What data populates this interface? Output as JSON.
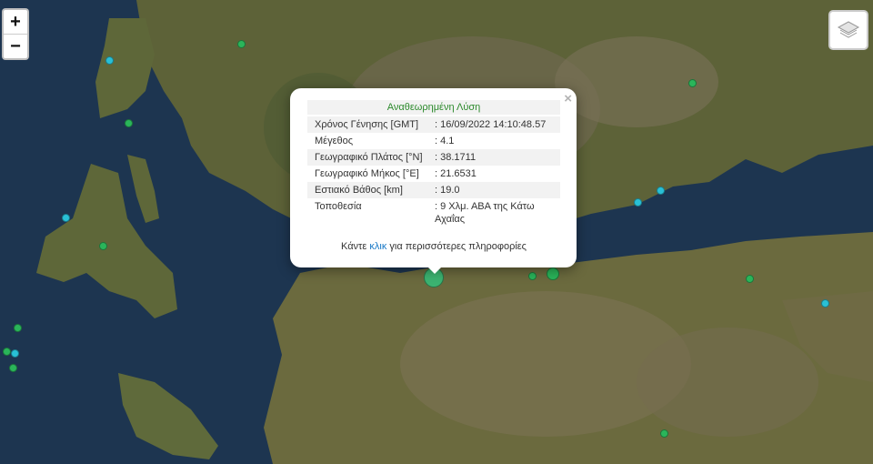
{
  "map": {
    "type": "satellite",
    "colors": {
      "sea": "#1d3550",
      "land": "#6b6a3e",
      "land_dark": "#4e5a33",
      "mountain": "#7a6f55"
    },
    "markers_note": "earthquake epicentres"
  },
  "zoom_controls": {
    "zoom_in": "+",
    "zoom_out": "−"
  },
  "layers_control": {
    "icon": "layers-icon"
  },
  "markers": [
    {
      "id": "selected",
      "color": "#3cb371",
      "size": "large",
      "selected": true
    },
    {
      "id": "m1",
      "color": "#2ab55a"
    },
    {
      "id": "m2",
      "color": "#2ab55a"
    },
    {
      "id": "m3",
      "color": "#2ab55a"
    },
    {
      "id": "m4",
      "color": "#2ab55a"
    },
    {
      "id": "m5",
      "color": "#2ab55a"
    },
    {
      "id": "m6",
      "color": "#2ab55a"
    },
    {
      "id": "m7",
      "color": "#2ab55a"
    },
    {
      "id": "m8",
      "color": "#2ab55a"
    },
    {
      "id": "m9",
      "color": "#2ab55a"
    },
    {
      "id": "m10",
      "color": "#2ab55a"
    },
    {
      "id": "m11",
      "color": "#2ab55a"
    },
    {
      "id": "c1",
      "color": "#29c0d6"
    },
    {
      "id": "c2",
      "color": "#29c0d6"
    },
    {
      "id": "c3",
      "color": "#29c0d6"
    },
    {
      "id": "c4",
      "color": "#29c0d6"
    },
    {
      "id": "c5",
      "color": "#29c0d6"
    },
    {
      "id": "c6",
      "color": "#29c0d6"
    }
  ],
  "popup": {
    "title": "Αναθεωρημένη Λύση",
    "close": "×",
    "rows": [
      {
        "label": "Χρόνος Γένησης [GMT]",
        "value": ": 16/09/2022 14:10:48.57"
      },
      {
        "label": "Μέγεθος",
        "value": ": 4.1"
      },
      {
        "label": "Γεωγραφικό Πλάτος [°N]",
        "value": ": 38.1711"
      },
      {
        "label": "Γεωγραφικό Μήκος [°E]",
        "value": ": 21.6531"
      },
      {
        "label": "Εστιακό Βάθος [km]",
        "value": ": 19.0"
      },
      {
        "label": "Τοποθεσία",
        "value": ": 9 Χλμ. ΑΒΑ της Κάτω Αχαΐας"
      }
    ],
    "more_prefix": "Κάντε ",
    "more_link": "κλικ",
    "more_suffix": " για περισσότερες πληροφορίες"
  }
}
